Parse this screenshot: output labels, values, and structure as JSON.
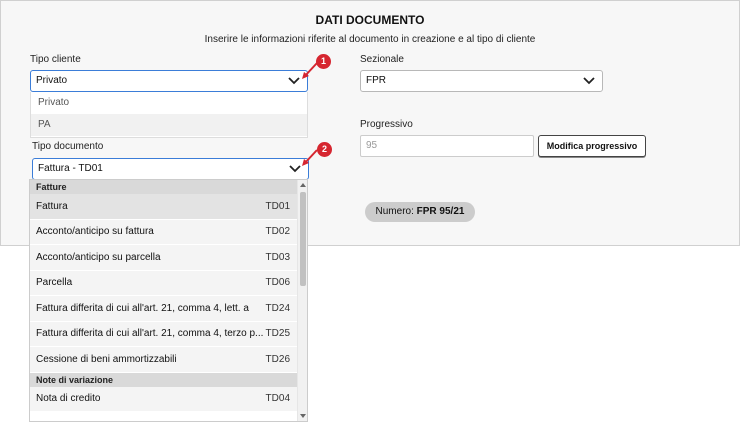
{
  "header": {
    "title": "DATI DOCUMENTO",
    "subtitle": "Inserire le informazioni riferite al documento in creazione e al tipo di cliente"
  },
  "tipo_cliente": {
    "label": "Tipo cliente",
    "value": "Privato",
    "options": [
      "Privato",
      "PA"
    ]
  },
  "sezionale": {
    "label": "Sezionale",
    "value": "FPR"
  },
  "progressivo": {
    "label": "Progressivo",
    "value": "95",
    "button": "Modifica progressivo"
  },
  "numero": {
    "prefix": "Numero:",
    "value": "FPR 95/21"
  },
  "tipo_documento": {
    "label": "Tipo documento",
    "value": "Fattura - TD01",
    "groups": [
      {
        "name": "Fatture",
        "items": [
          {
            "label": "Fattura",
            "code": "TD01"
          },
          {
            "label": "Acconto/anticipo su fattura",
            "code": "TD02"
          },
          {
            "label": "Acconto/anticipo su parcella",
            "code": "TD03"
          },
          {
            "label": "Parcella",
            "code": "TD06"
          },
          {
            "label": "Fattura differita di cui all'art. 21, comma 4, lett. a",
            "code": "TD24"
          },
          {
            "label": "Fattura differita di cui all'art. 21, comma 4, terzo p...",
            "code": "TD25"
          },
          {
            "label": "Cessione di beni ammortizzabili",
            "code": "TD26"
          }
        ]
      },
      {
        "name": "Note di variazione",
        "items": [
          {
            "label": "Nota di credito",
            "code": "TD04"
          }
        ]
      }
    ]
  },
  "markers": [
    "1",
    "2"
  ],
  "icons": {
    "chevron": "chevron-down-icon"
  },
  "colors": {
    "accent": "#3b7dd8",
    "marker": "#d62630"
  }
}
